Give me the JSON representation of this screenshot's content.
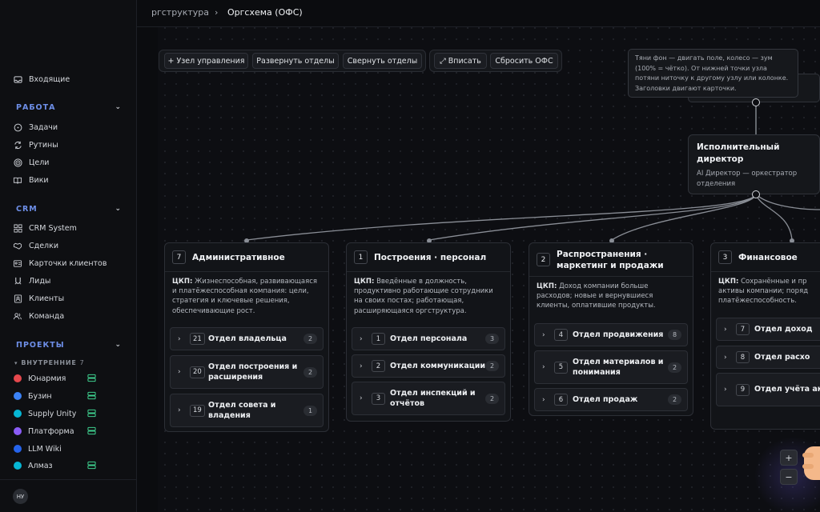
{
  "breadcrumb": {
    "parent": "ргструктура",
    "separator": "›",
    "current": "Оргсхема (ОФС)"
  },
  "sidebar": {
    "inbox": "Входящие",
    "work": {
      "header": "РАБОТА",
      "items": [
        "Задачи",
        "Рутины",
        "Цели",
        "Вики"
      ]
    },
    "crm": {
      "header": "CRM",
      "items": [
        "CRM System",
        "Сделки",
        "Карточки клиентов",
        "Лиды",
        "Клиенты",
        "Команда"
      ]
    },
    "projects": {
      "header": "ПРОЕКТЫ",
      "group": "ВНУТРЕННИЕ",
      "group_count": "7",
      "items": [
        {
          "name": "Юнармия",
          "color": "#e5484d",
          "server": true
        },
        {
          "name": "Бузин",
          "color": "#3b82f6",
          "server": true
        },
        {
          "name": "Supply Unity",
          "color": "#06b6d4",
          "server": true
        },
        {
          "name": "Платформа",
          "color": "#8b5cf6",
          "server": true
        },
        {
          "name": "LLM Wiki",
          "color": "#2563eb",
          "server": false
        },
        {
          "name": "Алмаз",
          "color": "#06b6d4",
          "server": true
        }
      ]
    },
    "avatar": "НУ"
  },
  "toolbar": {
    "add_node": "+ Узел управления",
    "expand": "Развернуть отделы",
    "collapse": "Свернуть отделы",
    "fit": "⤢ Вписать",
    "reset": "Сбросить ОФС"
  },
  "tooltip": "Тяни фон — двигать поле, колесо — зум (100% = чётко). От нижней точки узла потяни ниточку к другому узлу или колонке. Заголовки двигают карточки.",
  "executive": {
    "title": "Исполнительный директор",
    "subtitle": "AI Директор — оркестратор отделения"
  },
  "ckp_label": "ЦКП:",
  "departments": [
    {
      "num": "7",
      "title": "Административное",
      "ckp": "Жизнеспособная, развивающаяся и платёжеспособная компания: цели, стратегия и ключевые решения, обеспечивающие рост.",
      "units": [
        {
          "num": "21",
          "name": "Отдел владельца",
          "count": "2"
        },
        {
          "num": "20",
          "name": "Отдел построения и расширения",
          "count": "2"
        },
        {
          "num": "19",
          "name": "Отдел совета и владения",
          "count": "1"
        }
      ]
    },
    {
      "num": "1",
      "title": "Построения · персонал",
      "ckp": "Введённые в должность, продуктивно работающие сотрудники на своих постах; работающая, расширяющаяся оргструктура.",
      "units": [
        {
          "num": "1",
          "name": "Отдел персонала",
          "count": "3"
        },
        {
          "num": "2",
          "name": "Отдел коммуникации",
          "count": "2"
        },
        {
          "num": "3",
          "name": "Отдел инспекций и отчётов",
          "count": "2"
        }
      ]
    },
    {
      "num": "2",
      "title": "Распространения · маркетинг и продажи",
      "ckp": "Доход компании больше расходов; новые и вернувшиеся клиенты, оплатившие продукты.",
      "units": [
        {
          "num": "4",
          "name": "Отдел продвижения",
          "count": "8"
        },
        {
          "num": "5",
          "name": "Отдел материалов и понимания",
          "count": "2"
        },
        {
          "num": "6",
          "name": "Отдел продаж",
          "count": "2"
        }
      ]
    },
    {
      "num": "3",
      "title": "Финансовое",
      "ckp": "Сохранённые и пр активы компании; поряд платёжеспособность.",
      "units": [
        {
          "num": "7",
          "name": "Отдел доход",
          "count": ""
        },
        {
          "num": "8",
          "name": "Отдел расхо",
          "count": ""
        },
        {
          "num": "9",
          "name": "Отдел учёта активов",
          "count": ""
        }
      ]
    }
  ],
  "zoom": {
    "in": "+",
    "out": "−"
  }
}
